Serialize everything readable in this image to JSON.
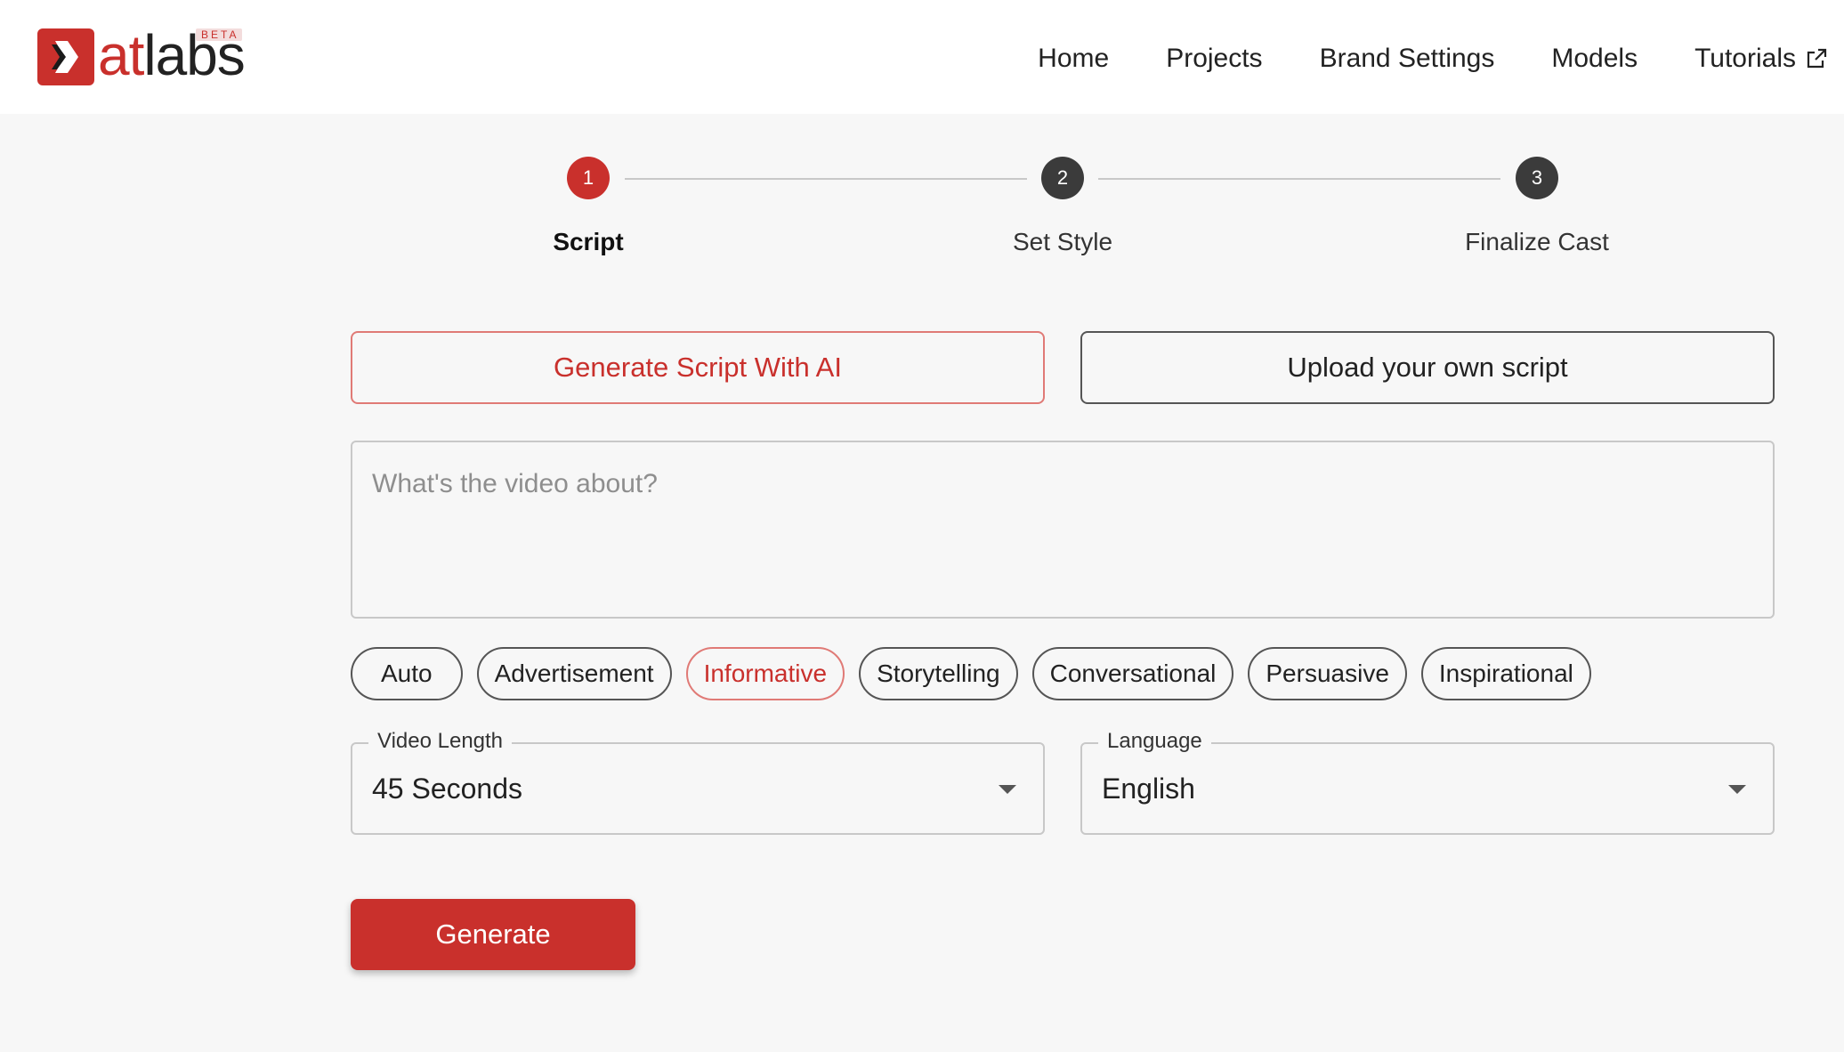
{
  "brand": {
    "name_accent": "at",
    "name_rest": "labs",
    "badge": "BETA"
  },
  "nav": {
    "items": [
      {
        "label": "Home"
      },
      {
        "label": "Projects"
      },
      {
        "label": "Brand Settings"
      },
      {
        "label": "Models"
      },
      {
        "label": "Tutorials",
        "icon": "external-link-icon"
      }
    ]
  },
  "stepper": {
    "steps": [
      {
        "number": "1",
        "label": "Script",
        "active": true
      },
      {
        "number": "2",
        "label": "Set Style",
        "active": false
      },
      {
        "number": "3",
        "label": "Finalize Cast",
        "active": false
      }
    ]
  },
  "mode": {
    "ai_label": "Generate Script With AI",
    "upload_label": "Upload your own script",
    "selected": "ai"
  },
  "prompt": {
    "placeholder": "What's the video about?",
    "value": ""
  },
  "tones": {
    "selected": "Informative",
    "items": [
      "Auto",
      "Advertisement",
      "Informative",
      "Storytelling",
      "Conversational",
      "Persuasive",
      "Inspirational"
    ]
  },
  "video_length": {
    "label": "Video Length",
    "value": "45 Seconds"
  },
  "language": {
    "label": "Language",
    "value": "English"
  },
  "generate_label": "Generate",
  "colors": {
    "accent": "#c9302c",
    "accent_border": "#e07a76",
    "dark": "#3b3b3b",
    "background": "#f7f7f7"
  }
}
